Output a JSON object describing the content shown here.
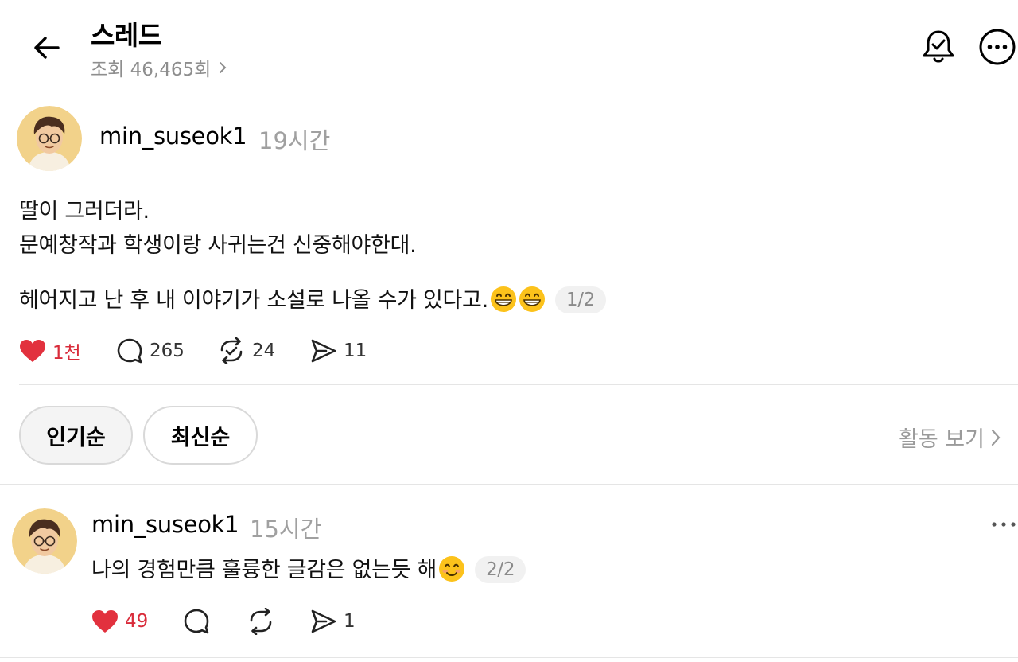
{
  "header": {
    "title": "스레드",
    "views": "조회 46,465회"
  },
  "post": {
    "username": "min_suseok1",
    "time": "19시간",
    "lines": [
      "딸이 그러더라.",
      "문예창작과 학생이랑 사귀는건 신중해야한대.",
      "헤어지고 난 후 내 이야기가 소설로 나올 수가 있다고."
    ],
    "page_indicator": "1/2",
    "likes": "1천",
    "replies": "265",
    "reposts": "24",
    "shares": "11"
  },
  "sort": {
    "popular": "인기순",
    "latest": "최신순",
    "activity": "활동 보기"
  },
  "comment": {
    "username": "min_suseok1",
    "time": "15시간",
    "text": "나의 경험만큼 훌륭한 글감은 없는듯 해",
    "page_indicator": "2/2",
    "likes": "49",
    "shares": "1"
  },
  "colors": {
    "like_red": "#d92c3b",
    "muted_gray": "#8e8e8e",
    "divider": "#e5e5e5"
  },
  "icons": [
    "back-arrow-icon",
    "bell-check-icon",
    "more-circle-icon",
    "chevron-right-icon",
    "heart-icon",
    "comment-icon",
    "repost-icon",
    "share-icon",
    "grin-emoji-icon",
    "smile-emoji-icon"
  ]
}
